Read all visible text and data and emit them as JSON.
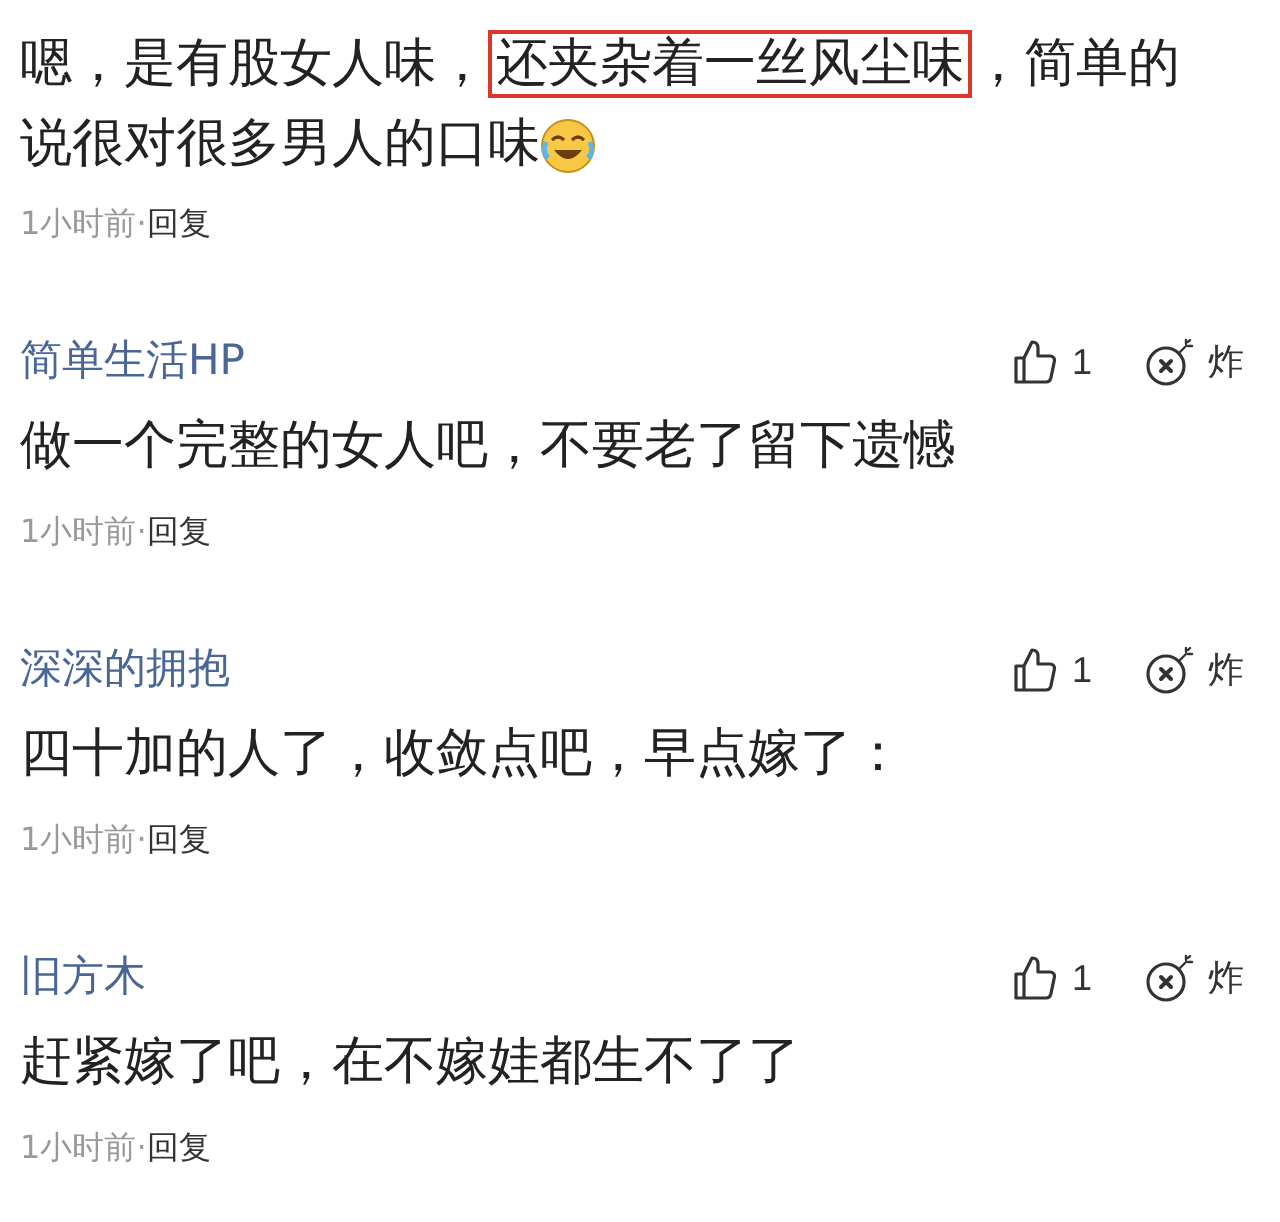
{
  "comments": [
    {
      "segments": [
        {
          "text": "嗯，是有股女人味，",
          "boxed": false
        },
        {
          "text": "还夹杂着一丝风尘味",
          "boxed": true
        },
        {
          "text": "，简单的说很对很多男人的口味",
          "boxed": false
        }
      ],
      "emoji": true,
      "time": "1小时前",
      "separator": "·",
      "reply": "回复"
    },
    {
      "user": "简单生活HP",
      "likes": "1",
      "bomb": "炸",
      "segments": [
        {
          "text": "做一个完整的女人吧，不要老了留下遗憾",
          "boxed": false
        }
      ],
      "emoji": false,
      "time": "1小时前",
      "separator": "·",
      "reply": "回复"
    },
    {
      "user": "深深的拥抱",
      "likes": "1",
      "bomb": "炸",
      "segments": [
        {
          "text": "四十加的人了，收敛点吧，早点嫁了：",
          "boxed": false
        }
      ],
      "emoji": false,
      "time": "1小时前",
      "separator": "·",
      "reply": "回复"
    },
    {
      "user": "旧方木",
      "likes": "1",
      "bomb": "炸",
      "segments": [
        {
          "text": "赶紧嫁了吧，在不嫁娃都生不了了",
          "boxed": false
        }
      ],
      "emoji": false,
      "time": "1小时前",
      "separator": "·",
      "reply": "回复"
    }
  ]
}
